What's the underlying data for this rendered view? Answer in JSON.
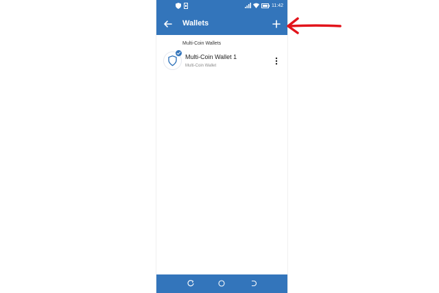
{
  "status_bar": {
    "time": "11:42",
    "icons": [
      "shield-status-icon",
      "sim-status-icon",
      "signal-icon",
      "wifi-icon",
      "battery-icon"
    ]
  },
  "app_bar": {
    "title": "Wallets",
    "back_icon": "back-arrow-icon",
    "add_icon": "plus-icon"
  },
  "section": {
    "header": "Multi-Coin Wallets"
  },
  "wallets": [
    {
      "name": "Multi-Coin Wallet 1",
      "subtitle": "Multi-Coin Wallet",
      "selected": true
    }
  ],
  "nav_bar": {
    "items": [
      "recent-apps-icon",
      "home-icon",
      "back-icon"
    ]
  },
  "colors": {
    "accent": "#3375bb",
    "annotation_arrow": "#e2141b"
  }
}
